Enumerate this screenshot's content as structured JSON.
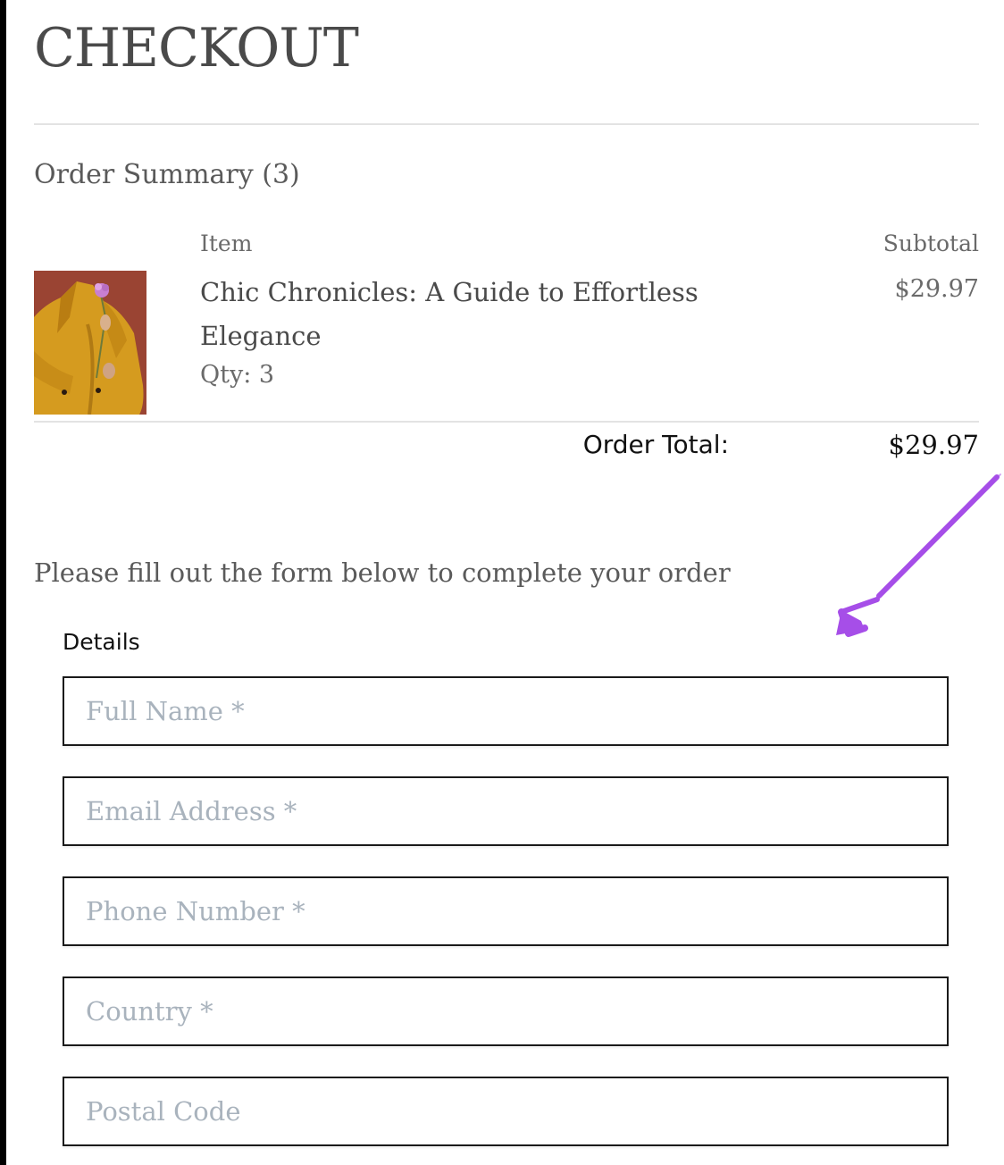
{
  "page": {
    "title": "CHECKOUT"
  },
  "order_summary": {
    "heading": "Order Summary (3)",
    "columns": {
      "item": "Item",
      "subtotal": "Subtotal"
    },
    "items": [
      {
        "name": "Chic Chronicles: A Guide to Effortless Elegance",
        "qty": "Qty: 3",
        "price": "$29.97",
        "thumbnail": "product-photo-yellow-coat-flower"
      }
    ],
    "total_label": "Order Total:",
    "total_value": "$29.97"
  },
  "form": {
    "intro": "Please fill out the form below to complete your order",
    "details_label": "Details",
    "fields": [
      {
        "placeholder": "Full Name *",
        "value": ""
      },
      {
        "placeholder": "Email Address *",
        "value": ""
      },
      {
        "placeholder": "Phone Number *",
        "value": ""
      },
      {
        "placeholder": "Country *",
        "value": ""
      },
      {
        "placeholder": "Postal Code",
        "value": ""
      }
    ]
  },
  "annotation": {
    "icon": "hand-drawn-arrow-icon",
    "color": "#a64ee8"
  },
  "colors": {
    "text": "#4a4a4a",
    "placeholder": "#a9b3bd",
    "field_border": "#1a1a1a",
    "divider": "#e3e3e3"
  }
}
